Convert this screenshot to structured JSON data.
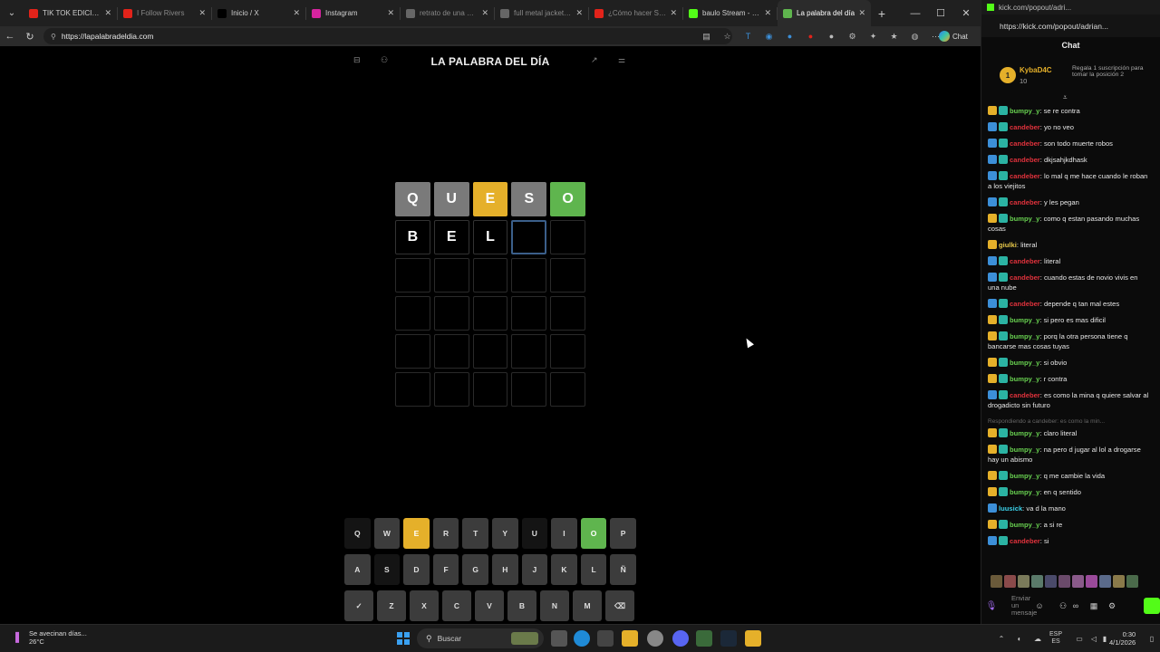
{
  "browser": {
    "tabs": [
      {
        "label": "TIK TOK EDICIÓN IN",
        "fav_color": "#e2231a",
        "active": false,
        "dim": false
      },
      {
        "label": "I Follow Rivers",
        "fav_color": "#e2231a",
        "active": false,
        "dim": true
      },
      {
        "label": "Inicio / X",
        "fav_color": "#000000",
        "active": false,
        "dim": false
      },
      {
        "label": "Instagram",
        "fav_color": "#d6249f",
        "active": false,
        "dim": false
      },
      {
        "label": "retrato de una muje",
        "fav_color": "#666666",
        "active": false,
        "dim": true
      },
      {
        "label": "full metal jacket - B",
        "fav_color": "#666666",
        "active": false,
        "dim": true
      },
      {
        "label": "¿Cómo hacer SPEED",
        "fav_color": "#e2231a",
        "active": false,
        "dim": true
      },
      {
        "label": "baulo Stream - Wat",
        "fav_color": "#53fc18",
        "active": false,
        "dim": false
      },
      {
        "label": "La palabra del día",
        "fav_color": "#5fb54e",
        "active": true,
        "dim": false
      }
    ],
    "url": "https://lapalabradeldia.com",
    "chat_button": "Chat"
  },
  "game": {
    "title": "LA PALABRA DEL DÍA",
    "board": [
      [
        {
          "l": "Q",
          "s": "absent"
        },
        {
          "l": "U",
          "s": "absent"
        },
        {
          "l": "E",
          "s": "present"
        },
        {
          "l": "S",
          "s": "absent"
        },
        {
          "l": "O",
          "s": "correct"
        }
      ],
      [
        {
          "l": "B",
          "s": "filled"
        },
        {
          "l": "E",
          "s": "filled"
        },
        {
          "l": "L",
          "s": "filled"
        },
        {
          "l": "",
          "s": "active"
        },
        {
          "l": "",
          "s": "empty"
        }
      ],
      [
        {
          "l": "",
          "s": "empty"
        },
        {
          "l": "",
          "s": "empty"
        },
        {
          "l": "",
          "s": "empty"
        },
        {
          "l": "",
          "s": "empty"
        },
        {
          "l": "",
          "s": "empty"
        }
      ],
      [
        {
          "l": "",
          "s": "empty"
        },
        {
          "l": "",
          "s": "empty"
        },
        {
          "l": "",
          "s": "empty"
        },
        {
          "l": "",
          "s": "empty"
        },
        {
          "l": "",
          "s": "empty"
        }
      ],
      [
        {
          "l": "",
          "s": "empty"
        },
        {
          "l": "",
          "s": "empty"
        },
        {
          "l": "",
          "s": "empty"
        },
        {
          "l": "",
          "s": "empty"
        },
        {
          "l": "",
          "s": "empty"
        }
      ],
      [
        {
          "l": "",
          "s": "empty"
        },
        {
          "l": "",
          "s": "empty"
        },
        {
          "l": "",
          "s": "empty"
        },
        {
          "l": "",
          "s": "empty"
        },
        {
          "l": "",
          "s": "empty"
        }
      ]
    ],
    "keyboard": [
      [
        {
          "k": "Q",
          "s": "dark"
        },
        {
          "k": "W",
          "s": ""
        },
        {
          "k": "E",
          "s": "present"
        },
        {
          "k": "R",
          "s": ""
        },
        {
          "k": "T",
          "s": ""
        },
        {
          "k": "Y",
          "s": ""
        },
        {
          "k": "U",
          "s": "dark"
        },
        {
          "k": "I",
          "s": ""
        },
        {
          "k": "O",
          "s": "correct"
        },
        {
          "k": "P",
          "s": ""
        }
      ],
      [
        {
          "k": "A",
          "s": ""
        },
        {
          "k": "S",
          "s": "dark"
        },
        {
          "k": "D",
          "s": ""
        },
        {
          "k": "F",
          "s": ""
        },
        {
          "k": "G",
          "s": ""
        },
        {
          "k": "H",
          "s": ""
        },
        {
          "k": "J",
          "s": ""
        },
        {
          "k": "K",
          "s": ""
        },
        {
          "k": "L",
          "s": ""
        },
        {
          "k": "Ñ",
          "s": ""
        }
      ],
      [
        {
          "k": "✓",
          "s": ""
        },
        {
          "k": "Z",
          "s": ""
        },
        {
          "k": "X",
          "s": ""
        },
        {
          "k": "C",
          "s": ""
        },
        {
          "k": "V",
          "s": ""
        },
        {
          "k": "B",
          "s": ""
        },
        {
          "k": "N",
          "s": ""
        },
        {
          "k": "M",
          "s": ""
        },
        {
          "k": "⌫",
          "s": ""
        }
      ]
    ]
  },
  "chat": {
    "popout_url": "https://kick.com/popout/adrian...",
    "tab_label": "kick.com/popout/adri...",
    "title": "Chat",
    "pinned": {
      "name": "KybaD4C",
      "count": "10",
      "message": "Regala 1 suscripción para tomar la posición 2",
      "rank": "1"
    },
    "messages": [
      {
        "user": "bumpy_y",
        "color": "green",
        "badges": [
          "gift",
          "mod"
        ],
        "text": "se re contra"
      },
      {
        "user": "candeber",
        "color": "red",
        "badges": [
          "sub",
          "mod"
        ],
        "text": "yo no veo"
      },
      {
        "user": "candeber",
        "color": "red",
        "badges": [
          "sub",
          "mod"
        ],
        "text": "son todo muerte robos"
      },
      {
        "user": "candeber",
        "color": "red",
        "badges": [
          "sub",
          "mod"
        ],
        "text": "dkjsahjkdhask"
      },
      {
        "user": "candeber",
        "color": "red",
        "badges": [
          "sub",
          "mod"
        ],
        "text": "lo mal q me hace cuando le roban a los viejitos"
      },
      {
        "user": "candeber",
        "color": "red",
        "badges": [
          "sub",
          "mod"
        ],
        "text": "y les pegan"
      },
      {
        "user": "bumpy_y",
        "color": "green",
        "badges": [
          "gift",
          "mod"
        ],
        "text": "como q estan pasando muchas cosas"
      },
      {
        "user": "giulki",
        "color": "yellow",
        "badges": [
          "gift"
        ],
        "text": "literal"
      },
      {
        "user": "candeber",
        "color": "red",
        "badges": [
          "sub",
          "mod"
        ],
        "text": "literal"
      },
      {
        "user": "candeber",
        "color": "red",
        "badges": [
          "sub",
          "mod"
        ],
        "text": "cuando estas de novio vivis en una nube"
      },
      {
        "user": "candeber",
        "color": "red",
        "badges": [
          "sub",
          "mod"
        ],
        "text": "depende q tan mal estes"
      },
      {
        "user": "bumpy_y",
        "color": "green",
        "badges": [
          "gift",
          "mod"
        ],
        "text": "si pero es mas dificil"
      },
      {
        "user": "bumpy_y",
        "color": "green",
        "badges": [
          "gift",
          "mod"
        ],
        "text": "porq la otra persona tiene q bancarse mas cosas tuyas"
      },
      {
        "user": "bumpy_y",
        "color": "green",
        "badges": [
          "gift",
          "mod"
        ],
        "text": "si obvio"
      },
      {
        "user": "bumpy_y",
        "color": "green",
        "badges": [
          "gift",
          "mod"
        ],
        "text": "r contra"
      },
      {
        "user": "candeber",
        "color": "red",
        "badges": [
          "sub",
          "mod"
        ],
        "text": "es como la mina q quiere salvar al drogadicto sin futuro"
      },
      {
        "reply": "Respondiendo a candeber: es como la min..."
      },
      {
        "user": "bumpy_y",
        "color": "green",
        "badges": [
          "gift",
          "mod"
        ],
        "text": "claro literal"
      },
      {
        "user": "bumpy_y",
        "color": "green",
        "badges": [
          "gift",
          "mod"
        ],
        "text": "na pero d jugar al lol a drogarse hay un abismo"
      },
      {
        "user": "bumpy_y",
        "color": "green",
        "badges": [
          "gift",
          "mod"
        ],
        "text": "q me cambie la vida"
      },
      {
        "user": "bumpy_y",
        "color": "green",
        "badges": [
          "gift",
          "mod"
        ],
        "text": "en q sentido"
      },
      {
        "user": "luusick",
        "color": "cyan",
        "badges": [
          "sub"
        ],
        "text": "va d la mano"
      },
      {
        "user": "bumpy_y",
        "color": "green",
        "badges": [
          "gift",
          "mod"
        ],
        "text": "a si re"
      },
      {
        "user": "candeber",
        "color": "red",
        "badges": [
          "sub",
          "mod"
        ],
        "text": "si"
      }
    ],
    "input_placeholder": "Enviar un mensaje"
  },
  "taskbar": {
    "weather_line1": "Se avecinan días...",
    "weather_line2": "26°C",
    "search": "Buscar",
    "lang_1": "ESP",
    "lang_2": "ES",
    "time": "0:30",
    "date": "4/1/2026"
  }
}
